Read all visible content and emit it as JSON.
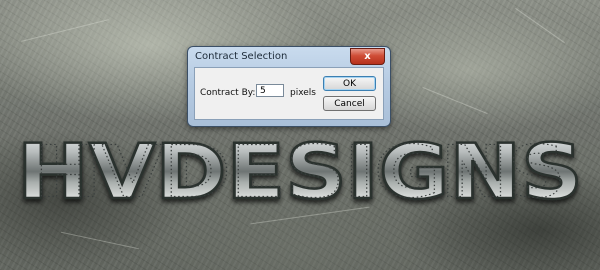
{
  "dialog": {
    "title": "Contract Selection",
    "close_glyph": "x",
    "contract_label": "Contract By:",
    "contract_value": "5",
    "units_label": "pixels",
    "ok_label": "OK",
    "cancel_label": "Cancel"
  },
  "artwork": {
    "title_text": "HVDESIGNS"
  },
  "colors": {
    "dialog_frame": "#b6cbe2",
    "close_button": "#cf4d37",
    "ok_focus": "#3c7fb1"
  }
}
